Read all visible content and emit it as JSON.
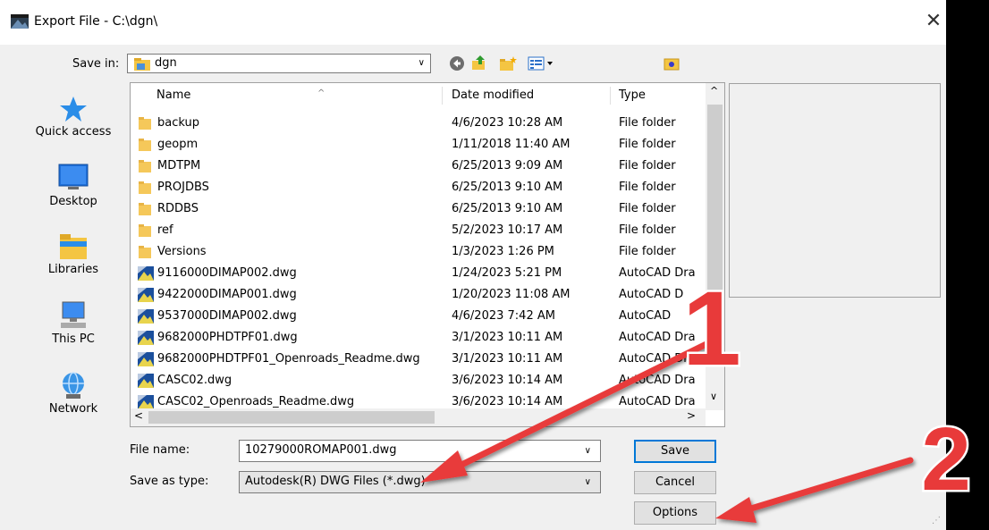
{
  "window": {
    "title": "Export File - C:\\dgn\\"
  },
  "save_in": {
    "label": "Save in:",
    "value": "dgn"
  },
  "places": [
    {
      "label": "Quick access",
      "icon": "star-icon"
    },
    {
      "label": "Desktop",
      "icon": "desktop-icon"
    },
    {
      "label": "Libraries",
      "icon": "libraries-icon"
    },
    {
      "label": "This PC",
      "icon": "computer-icon"
    },
    {
      "label": "Network",
      "icon": "network-icon"
    }
  ],
  "columns": {
    "name": "Name",
    "date": "Date modified",
    "type": "Type"
  },
  "files": [
    {
      "name": "backup",
      "date": "4/6/2023 10:28 AM",
      "type": "File folder",
      "kind": "folder"
    },
    {
      "name": "geopm",
      "date": "1/11/2018 11:40 AM",
      "type": "File folder",
      "kind": "folder"
    },
    {
      "name": "MDTPM",
      "date": "6/25/2013 9:09 AM",
      "type": "File folder",
      "kind": "folder"
    },
    {
      "name": "PROJDBS",
      "date": "6/25/2013 9:10 AM",
      "type": "File folder",
      "kind": "folder"
    },
    {
      "name": "RDDBS",
      "date": "6/25/2013 9:10 AM",
      "type": "File folder",
      "kind": "folder"
    },
    {
      "name": "ref",
      "date": "5/2/2023 10:17 AM",
      "type": "File folder",
      "kind": "folder"
    },
    {
      "name": "Versions",
      "date": "1/3/2023 1:26 PM",
      "type": "File folder",
      "kind": "folder"
    },
    {
      "name": "9116000DIMAP002.dwg",
      "date": "1/24/2023 5:21 PM",
      "type": "AutoCAD Dra",
      "kind": "dwg"
    },
    {
      "name": "9422000DIMAP001.dwg",
      "date": "1/20/2023 11:08 AM",
      "type": "AutoCAD D",
      "kind": "dwg"
    },
    {
      "name": "9537000DIMAP002.dwg",
      "date": "4/6/2023 7:42 AM",
      "type": "AutoCAD",
      "kind": "dwg"
    },
    {
      "name": "9682000PHDTPF01.dwg",
      "date": "3/1/2023 10:11 AM",
      "type": "AutoCAD Dra",
      "kind": "dwg"
    },
    {
      "name": "9682000PHDTPF01_Openroads_Readme.dwg",
      "date": "3/1/2023 10:11 AM",
      "type": "AutoCAD Dra",
      "kind": "dwg"
    },
    {
      "name": "CASC02.dwg",
      "date": "3/6/2023 10:14 AM",
      "type": "AutoCAD Dra",
      "kind": "dwg"
    },
    {
      "name": "CASC02_Openroads_Readme.dwg",
      "date": "3/6/2023 10:14 AM",
      "type": "AutoCAD Dra",
      "kind": "dwg"
    }
  ],
  "file_name": {
    "label": "File name:",
    "value": "10279000ROMAP001.dwg"
  },
  "save_as_type": {
    "label": "Save as type:",
    "value": "Autodesk(R) DWG Files (*.dwg)"
  },
  "buttons": {
    "save": "Save",
    "cancel": "Cancel",
    "options": "Options"
  },
  "annotations": {
    "marker1": "1",
    "marker2": "2",
    "color": "#e83a3a"
  }
}
